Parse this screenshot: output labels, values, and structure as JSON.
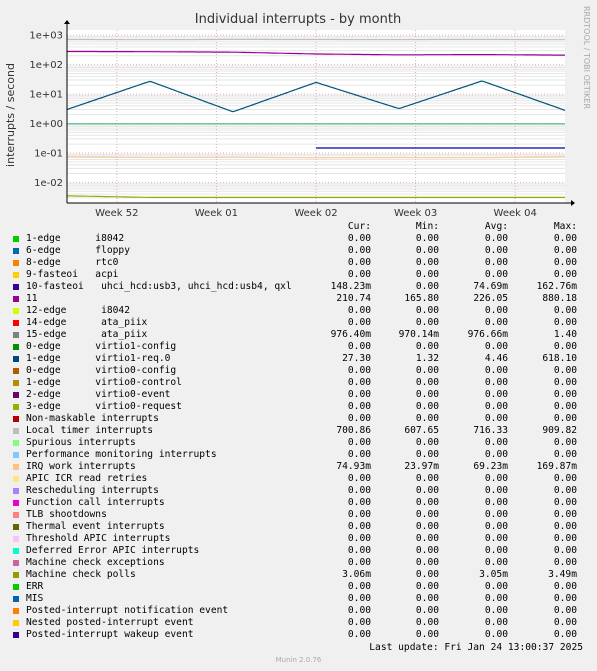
{
  "chart_data": {
    "type": "line",
    "title": "Individual interrupts - by month",
    "ylabel": "interrupts / second",
    "xlabel": "",
    "y_scale": "log",
    "ylim": [
      0.002,
      1500
    ],
    "y_ticks": [
      1000,
      100,
      10,
      1,
      0.1,
      0.01
    ],
    "y_tick_labels": [
      "1e+03",
      "1e+02",
      "1e+01",
      "1e+00",
      "1e-01",
      "1e-02"
    ],
    "x_ticks": [
      "Week 52",
      "Week 01",
      "Week 02",
      "Week 03",
      "Week 04"
    ],
    "grid": true,
    "watermark": "RRDTOOL / TOBI OETIKER",
    "series": [
      {
        "name": "Local timer interrupts",
        "color": "#c0c0c0",
        "values": [
          716,
          700,
          720,
          712,
          708,
          716,
          701
        ]
      },
      {
        "name": "11",
        "color": "#990099",
        "values": [
          280,
          275,
          265,
          230,
          215,
          220,
          210
        ]
      },
      {
        "name": "1-edge virtio1-req.0",
        "color": "#005577",
        "values": [
          3.0,
          27.3,
          2.5,
          25.0,
          3.2,
          28.0,
          2.8
        ]
      },
      {
        "name": "15-edge ata_piix",
        "color": "#40c080",
        "values": [
          0.98,
          0.976,
          0.98,
          0.976,
          0.978,
          0.976,
          0.976
        ]
      },
      {
        "name": "IRQ work interrupts",
        "color": "#ffcc99",
        "values": [
          0.075,
          0.07,
          0.072,
          0.068,
          0.07,
          0.069,
          0.075
        ]
      },
      {
        "name": "10-fasteoi uhci_hcd:usb3, uhci_hcd:usb4, qxl",
        "color": "#0000aa",
        "values": [
          0,
          0,
          0,
          0.148,
          0.148,
          0.148,
          0.148
        ]
      },
      {
        "name": "Machine check polls",
        "color": "#99aa00",
        "values": [
          0.0035,
          0.0031,
          0.0031,
          0.0031,
          0.0031,
          0.0031,
          0.0031
        ]
      }
    ]
  },
  "legend": {
    "headers": {
      "cur": "Cur:",
      "min": "Min:",
      "avg": "Avg:",
      "max": "Max:"
    },
    "rows": [
      {
        "color": "#00cc00",
        "label": "1-edge      i8042",
        "cur": "0.00",
        "min": "0.00",
        "avg": "0.00",
        "max": "0.00"
      },
      {
        "color": "#0066b3",
        "label": "6-edge      floppy",
        "cur": "0.00",
        "min": "0.00",
        "avg": "0.00",
        "max": "0.00"
      },
      {
        "color": "#ff8000",
        "label": "8-edge      rtc0",
        "cur": "0.00",
        "min": "0.00",
        "avg": "0.00",
        "max": "0.00"
      },
      {
        "color": "#ffcc00",
        "label": "9-fasteoi   acpi",
        "cur": "0.00",
        "min": "0.00",
        "avg": "0.00",
        "max": "0.00"
      },
      {
        "color": "#330099",
        "label": "10-fasteoi   uhci_hcd:usb3, uhci_hcd:usb4, qxl",
        "cur": "148.23m",
        "min": "0.00",
        "avg": "74.69m",
        "max": "162.76m"
      },
      {
        "color": "#990099",
        "label": "11",
        "cur": "210.74",
        "min": "165.80",
        "avg": "226.05",
        "max": "880.18"
      },
      {
        "color": "#ccff00",
        "label": "12-edge      i8042",
        "cur": "0.00",
        "min": "0.00",
        "avg": "0.00",
        "max": "0.00"
      },
      {
        "color": "#ff0000",
        "label": "14-edge      ata_piix",
        "cur": "0.00",
        "min": "0.00",
        "avg": "0.00",
        "max": "0.00"
      },
      {
        "color": "#808080",
        "label": "15-edge      ata_piix",
        "cur": "976.40m",
        "min": "970.14m",
        "avg": "976.66m",
        "max": "1.40"
      },
      {
        "color": "#008f00",
        "label": "0-edge      virtio1-config",
        "cur": "0.00",
        "min": "0.00",
        "avg": "0.00",
        "max": "0.00"
      },
      {
        "color": "#00487d",
        "label": "1-edge      virtio1-req.0",
        "cur": "27.30",
        "min": "1.32",
        "avg": "4.46",
        "max": "618.10"
      },
      {
        "color": "#b35a00",
        "label": "0-edge      virtio0-config",
        "cur": "0.00",
        "min": "0.00",
        "avg": "0.00",
        "max": "0.00"
      },
      {
        "color": "#b38f00",
        "label": "1-edge      virtio0-control",
        "cur": "0.00",
        "min": "0.00",
        "avg": "0.00",
        "max": "0.00"
      },
      {
        "color": "#6b006b",
        "label": "2-edge      virtio0-event",
        "cur": "0.00",
        "min": "0.00",
        "avg": "0.00",
        "max": "0.00"
      },
      {
        "color": "#8fb300",
        "label": "3-edge      virtio0-request",
        "cur": "0.00",
        "min": "0.00",
        "avg": "0.00",
        "max": "0.00"
      },
      {
        "color": "#b30000",
        "label": "Non-maskable interrupts",
        "cur": "0.00",
        "min": "0.00",
        "avg": "0.00",
        "max": "0.00"
      },
      {
        "color": "#bebebe",
        "label": "Local timer interrupts",
        "cur": "700.86",
        "min": "607.65",
        "avg": "716.33",
        "max": "909.82"
      },
      {
        "color": "#80ff80",
        "label": "Spurious interrupts",
        "cur": "0.00",
        "min": "0.00",
        "avg": "0.00",
        "max": "0.00"
      },
      {
        "color": "#80c9ff",
        "label": "Performance monitoring interrupts",
        "cur": "0.00",
        "min": "0.00",
        "avg": "0.00",
        "max": "0.00"
      },
      {
        "color": "#ffc080",
        "label": "IRQ work interrupts",
        "cur": "74.93m",
        "min": "23.97m",
        "avg": "69.23m",
        "max": "169.87m"
      },
      {
        "color": "#ffe680",
        "label": "APIC ICR read retries",
        "cur": "0.00",
        "min": "0.00",
        "avg": "0.00",
        "max": "0.00"
      },
      {
        "color": "#aa80ff",
        "label": "Rescheduling interrupts",
        "cur": "0.00",
        "min": "0.00",
        "avg": "0.00",
        "max": "0.00"
      },
      {
        "color": "#ee00cc",
        "label": "Function call interrupts",
        "cur": "0.00",
        "min": "0.00",
        "avg": "0.00",
        "max": "0.00"
      },
      {
        "color": "#ff8080",
        "label": "TLB shootdowns",
        "cur": "0.00",
        "min": "0.00",
        "avg": "0.00",
        "max": "0.00"
      },
      {
        "color": "#666600",
        "label": "Thermal event interrupts",
        "cur": "0.00",
        "min": "0.00",
        "avg": "0.00",
        "max": "0.00"
      },
      {
        "color": "#ffbfff",
        "label": "Threshold APIC interrupts",
        "cur": "0.00",
        "min": "0.00",
        "avg": "0.00",
        "max": "0.00"
      },
      {
        "color": "#00ffcc",
        "label": "Deferred Error APIC interrupts",
        "cur": "0.00",
        "min": "0.00",
        "avg": "0.00",
        "max": "0.00"
      },
      {
        "color": "#cc6699",
        "label": "Machine check exceptions",
        "cur": "0.00",
        "min": "0.00",
        "avg": "0.00",
        "max": "0.00"
      },
      {
        "color": "#999900",
        "label": "Machine check polls",
        "cur": "3.06m",
        "min": "0.00",
        "avg": "3.05m",
        "max": "3.49m"
      },
      {
        "color": "#00cc00",
        "label": "ERR",
        "cur": "0.00",
        "min": "0.00",
        "avg": "0.00",
        "max": "0.00"
      },
      {
        "color": "#0066b3",
        "label": "MIS",
        "cur": "0.00",
        "min": "0.00",
        "avg": "0.00",
        "max": "0.00"
      },
      {
        "color": "#ff8000",
        "label": "Posted-interrupt notification event",
        "cur": "0.00",
        "min": "0.00",
        "avg": "0.00",
        "max": "0.00"
      },
      {
        "color": "#ffcc00",
        "label": "Nested posted-interrupt event",
        "cur": "0.00",
        "min": "0.00",
        "avg": "0.00",
        "max": "0.00"
      },
      {
        "color": "#330099",
        "label": "Posted-interrupt wakeup event",
        "cur": "0.00",
        "min": "0.00",
        "avg": "0.00",
        "max": "0.00"
      }
    ]
  },
  "footer": {
    "last_update": "Last update: Fri Jan 24 13:00:37 2025",
    "munin_version": "Munin 2.0.76"
  }
}
